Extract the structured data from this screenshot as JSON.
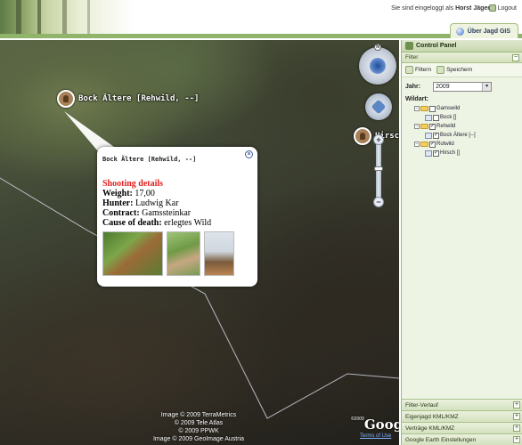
{
  "header": {
    "login_text": "Sie sind eingeloggt als",
    "username": "Horst Jäger",
    "logout_label": "Logout",
    "tab_label": "Über Jagd GIS"
  },
  "map": {
    "markers": [
      {
        "label": "Bock Ältere [Rehwild, --]"
      },
      {
        "label": "Hirsch"
      }
    ],
    "compass_n": "N",
    "zoom_in": "+",
    "zoom_out": "−",
    "attribution": [
      "Image © 2009 TerraMetrics",
      "© 2009 Tele Atlas",
      "© 2009 PPWK",
      "Image © 2009 GeoImage Austria"
    ],
    "logo": "Google",
    "logo_copyright": "©2009",
    "terms_link": "Terms of Use"
  },
  "popup": {
    "title": "Bock Ältere [Rehwild, --]",
    "close_symbol": "×",
    "heading": "Shooting details",
    "fields": [
      {
        "label": "Weight:",
        "value": "17,00"
      },
      {
        "label": "Hunter:",
        "value": "Ludwig Kar"
      },
      {
        "label": "Contract:",
        "value": "Gamssteinkar"
      },
      {
        "label": "Cause of death:",
        "value": "erlegtes Wild"
      }
    ]
  },
  "panel": {
    "title": "Control Panel",
    "filter_section": "Filter",
    "toggle_minus": "−",
    "filter_button": "Filtern",
    "save_button": "Speichern",
    "year_label": "Jahr:",
    "year_value": "2009",
    "wildart_label": "Wildart:",
    "tree": [
      {
        "label": "Gamswild",
        "checked": false,
        "children": [
          {
            "label": "Bock []",
            "checked": false
          }
        ]
      },
      {
        "label": "Rehwild",
        "checked": true,
        "children": [
          {
            "label": "Bock Ältere [--]",
            "checked": true
          }
        ]
      },
      {
        "label": "Rotwild",
        "checked": true,
        "children": [
          {
            "label": "Hirsch []",
            "checked": true
          }
        ]
      }
    ],
    "accordion": [
      "Filter-Verlauf",
      "Eigenjagd KML/KMZ",
      "Verträge KML/KMZ",
      "Google Earth Einstellungen"
    ],
    "accordion_plus": "+"
  }
}
